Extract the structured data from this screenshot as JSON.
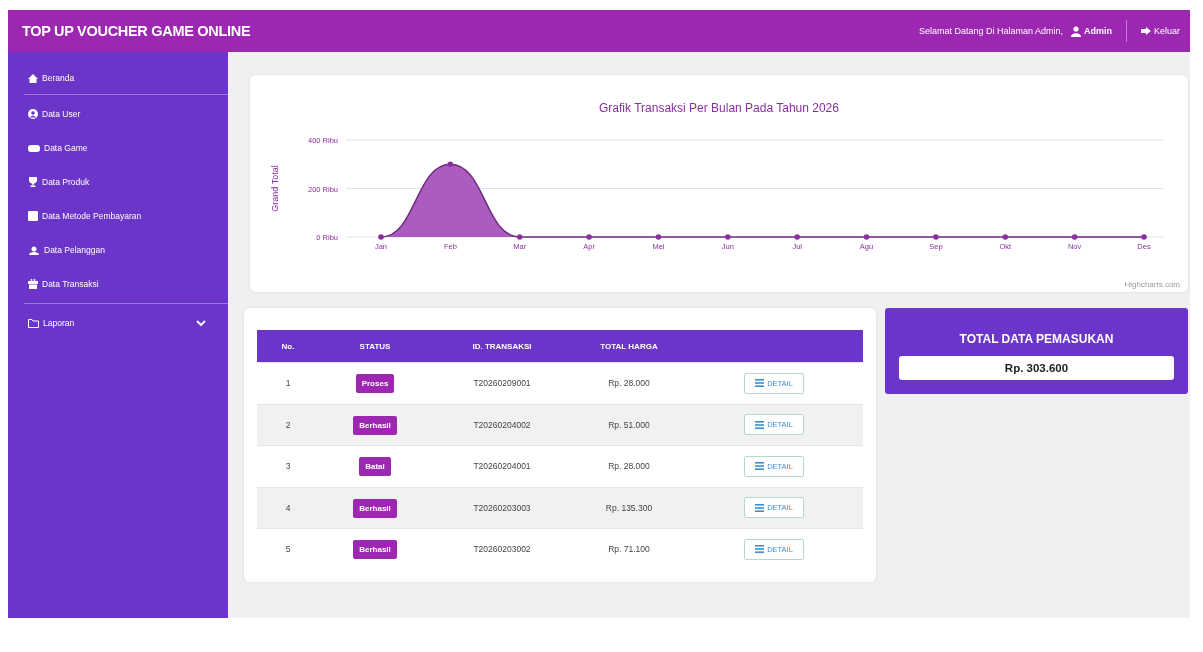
{
  "header": {
    "title": "TOP UP VOUCHER GAME ONLINE",
    "welcome": "Selamat Datang Di Halaman Admin,",
    "user": "Admin",
    "logout": "Keluar"
  },
  "sidebar": {
    "items": [
      {
        "label": "Beranda"
      },
      {
        "label": "Data User"
      },
      {
        "label": "Data Game"
      },
      {
        "label": "Data Produk"
      },
      {
        "label": "Data Metode Pembayaran"
      },
      {
        "label": "Data Pelanggan"
      },
      {
        "label": "Data Transaksi"
      },
      {
        "label": "Laporan"
      }
    ]
  },
  "chart": {
    "credit": "Highcharts.com",
    "chart_data": {
      "type": "area",
      "title": "Grafik Transaksi Per Bulan Pada Tahun 2026",
      "ylabel": "Grand Total",
      "categories": [
        "Jan",
        "Feb",
        "Mar",
        "Apr",
        "Mei",
        "Jun",
        "Jul",
        "Agu",
        "Sep",
        "Okt",
        "Nov",
        "Des"
      ],
      "series": [
        {
          "color": "#9b3fb5",
          "values": [
            0,
            300,
            0,
            0,
            0,
            0,
            0,
            0,
            0,
            0,
            0,
            0
          ]
        }
      ],
      "ylim": [
        0,
        400
      ],
      "yticks": [
        {
          "value": 0,
          "label": "0 Ribu"
        },
        {
          "value": 200,
          "label": "200 Ribu"
        },
        {
          "value": 400,
          "label": "400 Ribu"
        }
      ]
    }
  },
  "table": {
    "columns": [
      "No.",
      "STATUS",
      "ID. TRANSAKSI",
      "TOTAL HARGA"
    ],
    "rows": [
      {
        "no": "1",
        "status": "Proses",
        "id": "T20260209001",
        "total": "Rp. 28.000",
        "action": "DETAIL"
      },
      {
        "no": "2",
        "status": "Berhasil",
        "id": "T20260204002",
        "total": "Rp. 51.000",
        "action": "DETAIL"
      },
      {
        "no": "3",
        "status": "Batal",
        "id": "T20260204001",
        "total": "Rp. 28.000",
        "action": "DETAIL"
      },
      {
        "no": "4",
        "status": "Berhasil",
        "id": "T20260203003",
        "total": "Rp. 135.300",
        "action": "DETAIL"
      },
      {
        "no": "5",
        "status": "Berhasil",
        "id": "T20260203002",
        "total": "Rp. 71.100",
        "action": "DETAIL"
      }
    ]
  },
  "summary": {
    "title": "TOTAL DATA PEMASUKAN",
    "value": "Rp. 303.600"
  }
}
